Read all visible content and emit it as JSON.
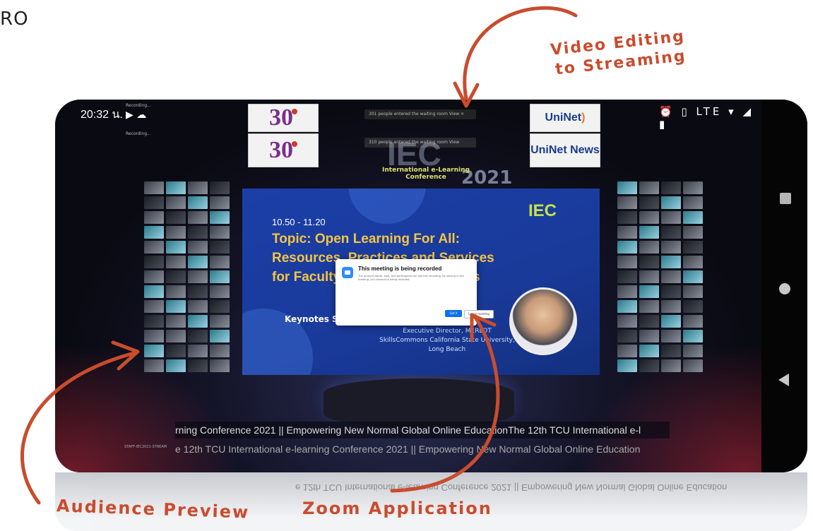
{
  "brand": "RO",
  "annotations": {
    "video_line1": "Video Editing",
    "video_line2": "to Streaming",
    "audience": "Audience Preview",
    "zoom": "Zoom Application"
  },
  "status_bar": {
    "time": "20:32 น.",
    "recording": "Recording...",
    "right_icons": "⏰ ▯ LTE ▾ ◢ ▮"
  },
  "zoom_notifications": {
    "waiting_1": "301 people entered the waiting room    View    ×",
    "waiting_2": "310 people entered the waiting room    View"
  },
  "logos": {
    "tcu": "30",
    "uninet": "UniNet",
    "uninet_news": "UniNet News"
  },
  "conference_banner": {
    "title": "International e-Learning Conference",
    "iec": "IEC",
    "year": "2021"
  },
  "slide": {
    "time": "10.50 - 11.20",
    "topic_line1": "Topic: Open Learning For All:",
    "topic_line2": "Resources, Practices and Services",
    "topic_line3": "for Faculty and Student Success",
    "keynotes": "Keynotes Speaker:",
    "speaker_line1": "Executive Director, MERLOT",
    "speaker_line2": "SkillsCommons California State University, Long Beach",
    "logo": "IEC"
  },
  "zoom_dialog": {
    "title": "This meeting is being recorded",
    "body": "The account owner, host, and participants can see this recording. By staying in this meeting, you consent to being recorded.",
    "ok_label": "Got it",
    "leave_label": "Leave meeting"
  },
  "ticker": {
    "line1": "rning Conference 2021 || Empowering New Normal Global Online EducationThe 12th TCU International e-l",
    "line2": "e 12th TCU International e-learning Conference 2021 || Empowering New Normal Global Online Education",
    "staff": "STAFF-IEC2021-STREAM"
  },
  "colors": {
    "annotation": "#c94c2e",
    "slide_bg": "#1b3fa8",
    "topic": "#f4c542",
    "zoom_blue": "#0e71eb"
  }
}
